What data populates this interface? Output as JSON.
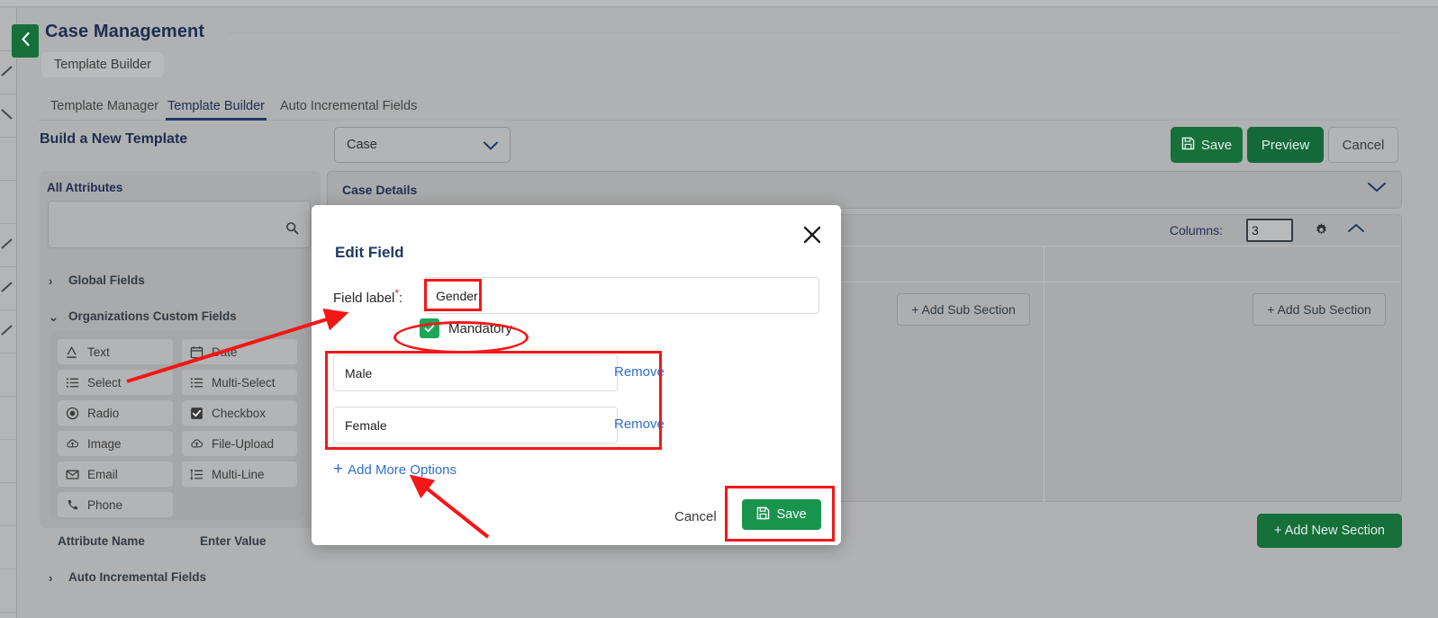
{
  "header": {
    "back_icon": "chevron-left-icon",
    "title": "Case Management",
    "breadcrumb_chip": "Template Builder"
  },
  "tabs": [
    {
      "label": "Template Manager",
      "active": false
    },
    {
      "label": "Template Builder",
      "active": true
    },
    {
      "label": "Auto Incremental Fields",
      "active": false
    }
  ],
  "build_row": {
    "title": "Build a New Template",
    "entity_select_value": "Case",
    "entity_select_icon": "chevron-down-icon",
    "save_label": "Save",
    "save_icon": "floppy-disk-icon",
    "preview_label": "Preview",
    "cancel_label": "Cancel"
  },
  "attributes_panel": {
    "title": "All Attributes",
    "search_placeholder": "",
    "search_value": "",
    "search_icon": "search-icon",
    "groups": [
      {
        "label": "Global Fields",
        "expanded": false,
        "icon": "chevron-right-icon"
      },
      {
        "label": "Organizations Custom Fields",
        "expanded": true,
        "icon": "chevron-down-icon"
      },
      {
        "label": "Auto Incremental Fields",
        "expanded": false,
        "icon": "chevron-right-icon"
      }
    ],
    "field_types": [
      {
        "label": "Text",
        "icon": "text-a-icon"
      },
      {
        "label": "Date",
        "icon": "calendar-icon"
      },
      {
        "label": "Select",
        "icon": "list-icon"
      },
      {
        "label": "Multi-Select",
        "icon": "list-icon"
      },
      {
        "label": "Radio",
        "icon": "radio-icon"
      },
      {
        "label": "Checkbox",
        "icon": "checkbox-icon"
      },
      {
        "label": "Image",
        "icon": "image-upload-icon"
      },
      {
        "label": "File-Upload",
        "icon": "cloud-upload-icon"
      },
      {
        "label": "Email",
        "icon": "envelope-icon"
      },
      {
        "label": "Multi-Line",
        "icon": "multiline-icon"
      },
      {
        "label": "Phone",
        "icon": "phone-icon"
      }
    ],
    "table_headers": [
      "Attribute Name",
      "Enter Value"
    ]
  },
  "builder": {
    "case_details_label": "Case Details",
    "case_details_collapse_icon": "chevron-down-icon",
    "columns_label": "Columns:",
    "columns_value": "3",
    "settings_icon": "gear-icon",
    "collapse_icon": "chevron-up-icon",
    "add_sub_section_label": "+ Add Sub Section",
    "add_new_section_label": "+ Add New Section"
  },
  "modal": {
    "title": "Edit Field",
    "close_icon": "close-x-icon",
    "field_label_text": "Field label",
    "field_label_required": "*",
    "field_label_colon": ":",
    "field_label_value": "Gender",
    "mandatory_label": "Mandatory",
    "mandatory_checked": true,
    "options": [
      {
        "value": "Male",
        "remove_label": "Remove"
      },
      {
        "value": "Female",
        "remove_label": "Remove"
      }
    ],
    "add_more_options_label": "Add More Options",
    "add_more_plus": "+",
    "cancel_label": "Cancel",
    "save_label": "Save",
    "save_icon": "floppy-disk-icon"
  },
  "annotations": {
    "color": "#f31717",
    "shapes": [
      "rect-around-field-label-input",
      "ellipse-around-mandatory-checkbox",
      "rect-around-options-list",
      "rect-around-save-button",
      "arrow-from-select-chip-to-modal",
      "arrow-to-add-more-options"
    ]
  },
  "colors": {
    "brand_green": "#15703a",
    "accent_blue": "#2f6fd0",
    "title_navy": "#1f3864",
    "annotation_red": "#f31717",
    "checkbox_green": "#1da65a",
    "page_gray": "#b0b1b2"
  }
}
